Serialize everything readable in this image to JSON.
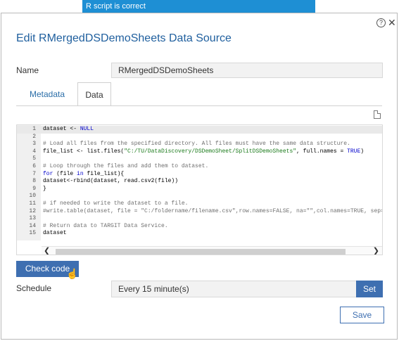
{
  "toast": {
    "message": "R script is correct"
  },
  "dialog": {
    "title": "Edit RMergedDSDemoSheets Data Source",
    "help_icon": "?",
    "close_icon": "✕",
    "name_label": "Name",
    "name_value": "RMergedDSDemoSheets",
    "tabs": [
      {
        "label": "Metadata",
        "active": false
      },
      {
        "label": "Data",
        "active": true
      }
    ],
    "check_button": "Check code",
    "schedule_label": "Schedule",
    "schedule_value": "Every 15 minute(s)",
    "set_button": "Set",
    "save_button": "Save"
  },
  "editor": {
    "active_line": 1,
    "lines": [
      {
        "n": "1",
        "text": "dataset <- NULL"
      },
      {
        "n": "2",
        "text": ""
      },
      {
        "n": "3",
        "text": "# Load all files from the specified directory. All files must have the same data structure."
      },
      {
        "n": "4",
        "text": "file_list <- list.files(\"C:/TU/DataDiscovery/DSDemoSheet/SplitDSDemoSheets\", full.names = TRUE)"
      },
      {
        "n": "5",
        "text": ""
      },
      {
        "n": "6",
        "text": "# Loop through the files and add them to dataset."
      },
      {
        "n": "7",
        "text": "for (file in file_list){"
      },
      {
        "n": "8",
        "text": "dataset<-rbind(dataset, read.csv2(file))"
      },
      {
        "n": "9",
        "text": "}"
      },
      {
        "n": "10",
        "text": ""
      },
      {
        "n": "11",
        "text": "# if needed to write the dataset to a file."
      },
      {
        "n": "12",
        "text": "#write.table(dataset, file = \"C:/foldername/filename.csv\",row.names=FALSE, na=\"\",col.names=TRUE, sep=\";\")"
      },
      {
        "n": "13",
        "text": ""
      },
      {
        "n": "14",
        "text": "# Return data to TARGIT Data Service."
      },
      {
        "n": "15",
        "text": "dataset"
      }
    ]
  },
  "colors": {
    "accent": "#3e6fb1",
    "toast": "#1e8fd4",
    "title": "#1f5f9e"
  }
}
